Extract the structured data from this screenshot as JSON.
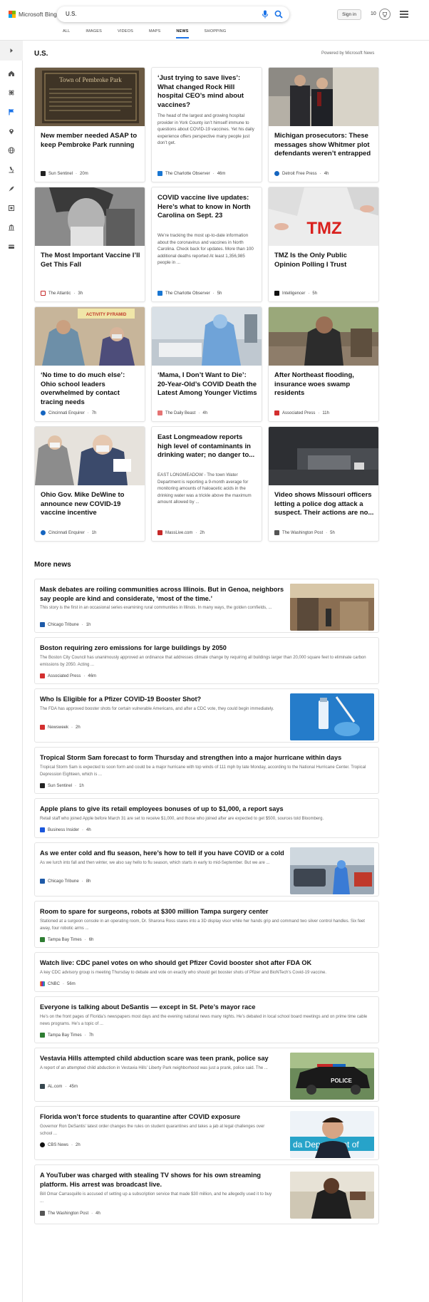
{
  "brand": {
    "name": "Microsoft Bing",
    "logo_colors": [
      "#f25022",
      "#7fba00",
      "#00a4ef",
      "#ffb900"
    ]
  },
  "search": {
    "value": "U.S."
  },
  "header": {
    "signin_label": "Sign in",
    "rewards_count": "10"
  },
  "tabs": [
    {
      "label": "ALL"
    },
    {
      "label": "IMAGES"
    },
    {
      "label": "VIDEOS"
    },
    {
      "label": "MAPS"
    },
    {
      "label": "NEWS"
    },
    {
      "label": "SHOPPING"
    }
  ],
  "active_tab": "NEWS",
  "accent_color": "#1a73e8",
  "rail_icons": [
    "chevron-right-icon",
    "home-icon",
    "science-icon",
    "flag-icon",
    "location-pin-icon",
    "globe-icon",
    "microscope-icon",
    "rocket-icon",
    "film-icon",
    "bank-icon",
    "card-icon"
  ],
  "section": {
    "title": "U.S.",
    "powered_by": "Powered by Microsoft News"
  },
  "cards": [
    {
      "title": "New member needed ASAP to keep Pembroke Park running",
      "desc": "",
      "source": "Sun Sentinel",
      "time": "20m"
    },
    {
      "title": "‘Just trying to save lives’: What changed Rock Hill hospital CEO’s mind about vaccines?",
      "desc": "The head of the largest and growing hospital provider in York County isn’t himself immune to questions about COVID-19 vaccines. Yet his daily experience offers perspective many people just don’t get.",
      "source": "The Charlotte Observer",
      "time": "46m"
    },
    {
      "title": "Michigan prosecutors: These messages show Whitmer plot defendants weren’t entrapped",
      "desc": "",
      "source": "Detroit Free Press",
      "time": "4h"
    },
    {
      "title": "The Most Important Vaccine I’ll Get This Fall",
      "desc": "",
      "source": "The Atlantic",
      "time": "3h"
    },
    {
      "title": "COVID vaccine live updates: Here’s what to know in North Carolina on Sept. 23",
      "desc": "We’re tracking the most up-to-date information about the coronavirus and vaccines in North Carolina. Check back for updates. More than 100 additional deaths reported At least 1,356,985 people in ...",
      "source": "The Charlotte Observer",
      "time": "5h"
    },
    {
      "title": "TMZ Is the Only Public Opinion Polling I Trust",
      "desc": "",
      "source": "Intelligencer",
      "time": "5h"
    },
    {
      "title": "‘No time to do much else’: Ohio school leaders overwhelmed by contact tracing needs",
      "desc": "",
      "source": "Cincinnati Enquirer",
      "time": "7h"
    },
    {
      "title": "‘Mama, I Don’t Want to Die’: 20-Year-Old’s COVID Death the Latest Among Younger Victims",
      "desc": "",
      "source": "The Daily Beast",
      "time": "4h"
    },
    {
      "title": "After Northeast flooding, insurance woes swamp residents",
      "desc": "",
      "source": "Associated Press",
      "time": "11h"
    },
    {
      "title": "Ohio Gov. Mike DeWine to announce new COVID-19 vaccine incentive",
      "desc": "",
      "source": "Cincinnati Enquirer",
      "time": "1h"
    },
    {
      "title": "East Longmeadow reports high level of contaminants in drinking water; no danger to...",
      "desc": "EAST LONGMEADOW - The town Water Department is reporting a 9-month average for monitoring amounts of haloacetic acids in the drinking water was a trickle above the maximum amount allowed by ...",
      "source": "MassLive.com",
      "time": "2h"
    },
    {
      "title": "Video shows Missouri officers letting a police dog attack a suspect. Their actions are no...",
      "desc": "",
      "source": "The Washington Post",
      "time": "5h"
    }
  ],
  "card_image_text": {
    "plaque": "Town of Pembroke Park",
    "tmz": "TMZ",
    "pyramid": "ACTIVITY PYRAMID"
  },
  "more_news": {
    "title": "More news",
    "items": [
      {
        "title": "Mask debates are roiling communities across Illinois. But in Genoa, neighbors say people are kind and considerate, ‘most of the time.’",
        "desc": "This story is the first in an occasional series examining rural communities in Illinois. In many ways, the golden cornfields, ...",
        "source": "Chicago Tribune",
        "time": "1h"
      },
      {
        "title": "Boston requiring zero emissions for large buildings by 2050",
        "desc": "The Boston City Council has unanimously approved an ordinance that addresses climate change by requiring all buildings larger than 20,000 square feet to eliminate carbon emissions by 2050. Acting ...",
        "source": "Associated Press",
        "time": "46m"
      },
      {
        "title": "Who Is Eligible for a Pfizer COVID-19 Booster Shot?",
        "desc": "The FDA has approved booster shots for certain vulnerable Americans, and after a CDC vote, they could begin immediately.",
        "source": "Newsweek",
        "time": "2h"
      },
      {
        "title": "Tropical Storm Sam forecast to form Thursday and strengthen into a major hurricane within days",
        "desc": "Tropical Storm Sam is expected to soon form and could be a major hurricane with top winds of 111 mph by late Monday, according to the National Hurricane Center. Tropical Depression Eighteen, which is ...",
        "source": "Sun Sentinel",
        "time": "1h"
      },
      {
        "title": "Apple plans to give its retail employees bonuses of up to $1,000, a report says",
        "desc": "Retail staff who joined Apple before March 31 are set to receive $1,000, and those who joined after are expected to get $500, sources told Bloomberg.",
        "source": "Business Insider",
        "time": "4h"
      },
      {
        "title": "As we enter cold and flu season, here’s how to tell if you have COVID or a cold",
        "desc": "As we lurch into fall and then winter, we also say hello to flu season, which starts in early to mid-September. But we are ...",
        "source": "Chicago Tribune",
        "time": "8h"
      },
      {
        "title": "Room to spare for surgeons, robots at $300 million Tampa surgery center",
        "desc": "Stationed at a surgeon console in an operating room, Dr. Sharona Ross stares into a 3D display visor while her hands grip and command two silver control handles. Six feet away, four robotic arms ...",
        "source": "Tampa Bay Times",
        "time": "6h"
      },
      {
        "title": "Watch live: CDC panel votes on who should get Pfizer Covid booster shot after FDA OK",
        "desc": "A key CDC advisory group is meeting Thursday to debate and vote on exactly who should get booster shots of Pfizer and BioNTech’s Covid-19 vaccine.",
        "source": "CNBC",
        "time": "56m"
      },
      {
        "title": "Everyone is talking about DeSantis — except in St. Pete’s mayor race",
        "desc": "He’s on the front pages of Florida’s newspapers most days and the evening national news many nights. He’s debated in local school board meetings and on prime time cable news programs. He’s a topic of ...",
        "source": "Tampa Bay Times",
        "time": "7h"
      },
      {
        "title": "Vestavia Hills attempted child abduction scare was teen prank, police say",
        "desc": "A report of an attempted child abduction in Vestavia Hills’ Liberty Park neighborhood was just a prank, police said. The ...",
        "source": "AL.com",
        "time": "45m"
      },
      {
        "title": "Florida won’t force students to quarantine after COVID exposure",
        "desc": "Governor Ron DeSantis’ latest order changes the rules on student quarantines and takes a jab at legal challenges over school ...",
        "source": "CBS News",
        "time": "2h"
      },
      {
        "title": "A YouTuber was charged with stealing TV shows for his own streaming platform. His arrest was broadcast live.",
        "desc": "Bill Omar Carrasquillo is accused of setting up a subscription service that made $30 million, and he allegedly used it to buy ...",
        "source": "The Washington Post",
        "time": "4h"
      }
    ]
  },
  "list_image_text": {
    "police": "POLICE",
    "desantis_banner": "da Department of"
  }
}
